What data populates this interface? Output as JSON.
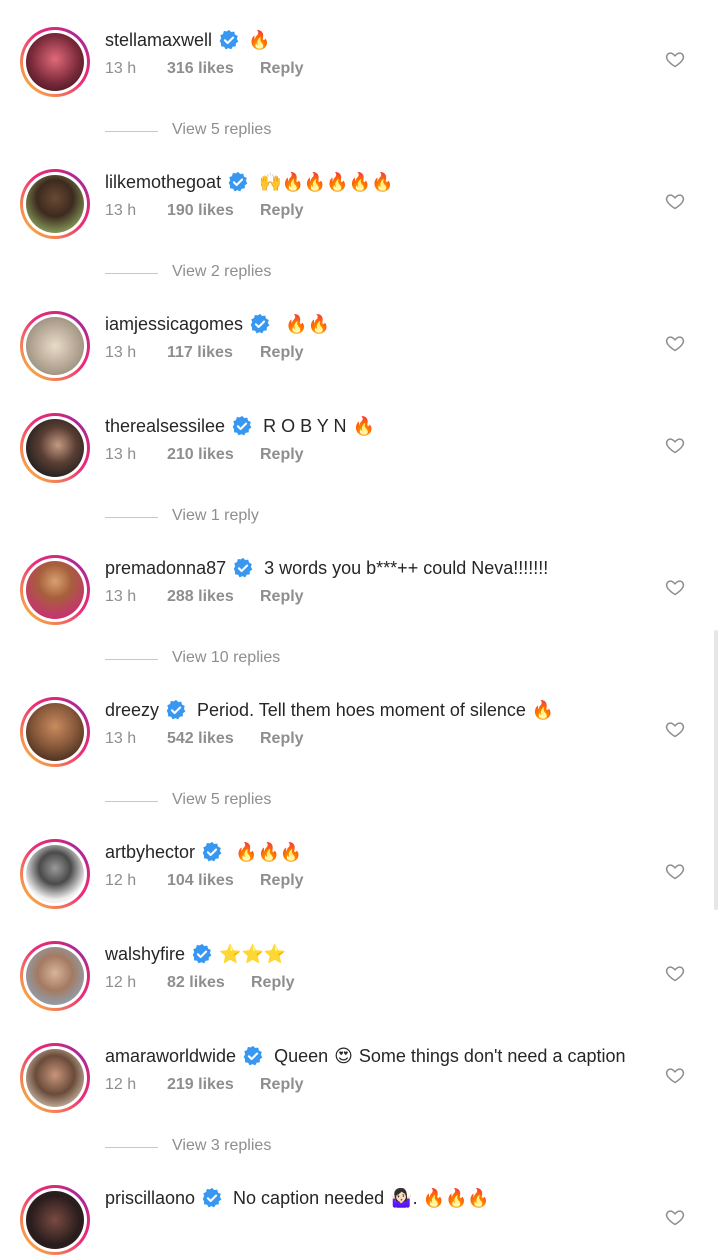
{
  "colors": {
    "verified_blue": "#3897f0",
    "meta_gray": "#8e8e8e",
    "text": "#262626"
  },
  "comments": [
    {
      "username": "stellamaxwell",
      "text": "",
      "emoji": "🔥",
      "time": "13 h",
      "likes": "316 likes",
      "reply": "Reply",
      "replies": "View 5 replies",
      "avatar_color": "#7a2a3a"
    },
    {
      "username": "lilkemothegoat",
      "text": "",
      "emoji": "🙌🔥🔥🔥🔥🔥",
      "time": "13 h",
      "likes": "190 likes",
      "reply": "Reply",
      "replies": "View 2 replies",
      "avatar_color": "#4f6b3a"
    },
    {
      "username": "iamjessicagomes",
      "text": "",
      "emoji": "🔥🔥",
      "time": "13 h",
      "likes": "117 likes",
      "reply": "Reply",
      "replies": "",
      "avatar_color": "#b9aa98"
    },
    {
      "username": "therealsessilee",
      "text": "R O B Y N",
      "emoji": "🔥",
      "time": "13 h",
      "likes": "210 likes",
      "reply": "Reply",
      "replies": "View 1 reply",
      "avatar_color": "#3a3a3a"
    },
    {
      "username": "premadonna87",
      "text": "3 words you b***++ could Neva!!!!!!!",
      "emoji": "",
      "time": "13 h",
      "likes": "288 likes",
      "reply": "Reply",
      "replies": "View 10 replies",
      "avatar_color": "#c4356d"
    },
    {
      "username": "dreezy",
      "text": "Period. Tell them hoes moment of silence",
      "emoji": "🔥",
      "time": "13 h",
      "likes": "542 likes",
      "reply": "Reply",
      "replies": "View 5 replies",
      "avatar_color": "#8a5a3c"
    },
    {
      "username": "artbyhector",
      "text": "",
      "emoji": "🔥🔥🔥",
      "time": "12 h",
      "likes": "104 likes",
      "reply": "Reply",
      "replies": "",
      "avatar_color": "#d8d8d8"
    },
    {
      "username": "walshyfire",
      "text": "",
      "emoji": "⭐⭐⭐",
      "time": "12 h",
      "likes": "82 likes",
      "reply": "Reply",
      "replies": "",
      "avatar_color": "#8ea3b5"
    },
    {
      "username": "amaraworldwide",
      "text": "Queen",
      "emoji": "😍",
      "text2": "Some things don't need a caption",
      "time": "12 h",
      "likes": "219 likes",
      "reply": "Reply",
      "replies": "View 3 replies",
      "avatar_color": "#6a4b3a"
    },
    {
      "username": "priscillaono",
      "text": "No caption needed",
      "emoji": "🤷🏻‍♀️. 🔥🔥🔥",
      "time": "",
      "likes": "",
      "reply": "",
      "replies": "",
      "avatar_color": "#2a1d1d"
    }
  ]
}
